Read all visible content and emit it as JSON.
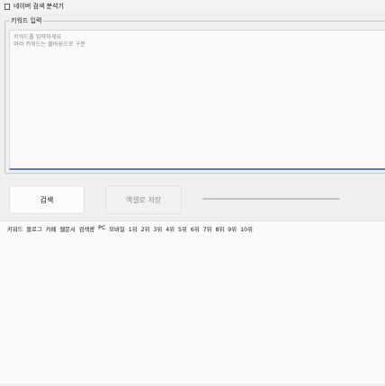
{
  "window": {
    "title": "네이버 검색 분석기"
  },
  "input_group": {
    "label": "키워드 입력",
    "placeholder": "키워드를 입력하세요\n여러 키워드는 줄바꿈으로 구분"
  },
  "buttons": {
    "search": "검색",
    "excel": "엑셀로 저장"
  },
  "progress": {
    "value": 0
  },
  "table": {
    "columns": [
      "키워드",
      "블로그",
      "카페",
      "웹문서",
      "검색량",
      "PC",
      "모바일",
      "1위",
      "2위",
      "3위",
      "4위",
      "5위",
      "6위",
      "7위",
      "8위",
      "9위",
      "10위"
    ]
  }
}
